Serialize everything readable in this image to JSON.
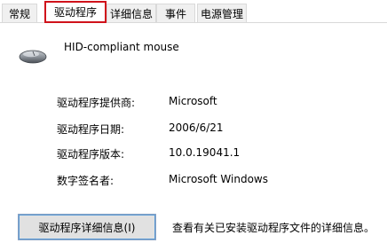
{
  "tabs": [
    {
      "label": "常规",
      "active": false
    },
    {
      "label": "驱动程序",
      "active": true
    },
    {
      "label": "详细信息",
      "active": false
    },
    {
      "label": "事件",
      "active": false
    },
    {
      "label": "电源管理",
      "active": false
    }
  ],
  "device": {
    "name": "HID-compliant mouse",
    "icon": "mouse-icon"
  },
  "driver_info": [
    {
      "label": "驱动程序提供商:",
      "value": "Microsoft"
    },
    {
      "label": "驱动程序日期:",
      "value": "2006/6/21"
    },
    {
      "label": "驱动程序版本:",
      "value": "10.0.19041.1"
    },
    {
      "label": "数字签名者:",
      "value": "Microsoft Windows"
    }
  ],
  "actions": {
    "details_button": "驱动程序详细信息(I)",
    "details_desc": "查看有关已安装驱动程序文件的详细信息。"
  },
  "colors": {
    "active_tab_highlight": "#d0121b",
    "button_focus": "#5a9bd6"
  }
}
